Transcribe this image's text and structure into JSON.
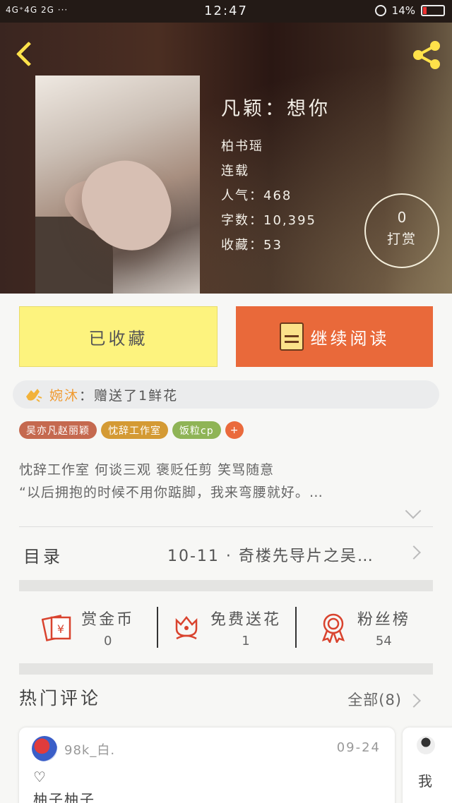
{
  "status_bar": {
    "network": "4G⁺4G 2G ···",
    "time": "12:47",
    "battery": "14%",
    "battery_color": "#e33333"
  },
  "hero": {
    "title": "凡颖：想你",
    "author": "柏书瑶",
    "state": "连载",
    "popularity": "人气：468",
    "words": "字数：10,395",
    "favorites": "收藏：53",
    "reward_count": "0",
    "reward_label": "打赏",
    "accent_color": "#ffe24a"
  },
  "actions": {
    "collected_label": "已收藏",
    "continue_label": "继续阅读",
    "collected_color": "#fdf37e",
    "continue_color": "#e9693a"
  },
  "gift": {
    "user": "婉沐",
    "separator": "：",
    "message": "赠送了1鲜花"
  },
  "tags": [
    {
      "label": "吴亦凡赵丽颖",
      "color": "#c5694f"
    },
    {
      "label": "忱辞工作室",
      "color": "#d49a34"
    },
    {
      "label": "饭粒cp",
      "color": "#8fb456"
    }
  ],
  "tag_add": "+",
  "description": {
    "line1": "忱辞工作室 何谈三观 褒贬任剪 笑骂随意",
    "line2": "“以后拥抱的时候不用你踮脚，我来弯腰就好。…"
  },
  "toc": {
    "label": "目录",
    "latest": "10-11 · 奇楼先导片之吴…"
  },
  "stats": [
    {
      "title": "赏金币",
      "value": "0",
      "icon": "reward-coin-icon"
    },
    {
      "title": "免费送花",
      "value": "1",
      "icon": "flower-icon"
    },
    {
      "title": "粉丝榜",
      "value": "54",
      "icon": "medal-icon"
    }
  ],
  "comments": {
    "title": "热门评论",
    "all_label": "全部(8)",
    "items": [
      {
        "user": "98k_白.",
        "date": "09-24",
        "heart": "♡",
        "text": "柚子柚子"
      },
      {
        "text": "我"
      }
    ]
  }
}
